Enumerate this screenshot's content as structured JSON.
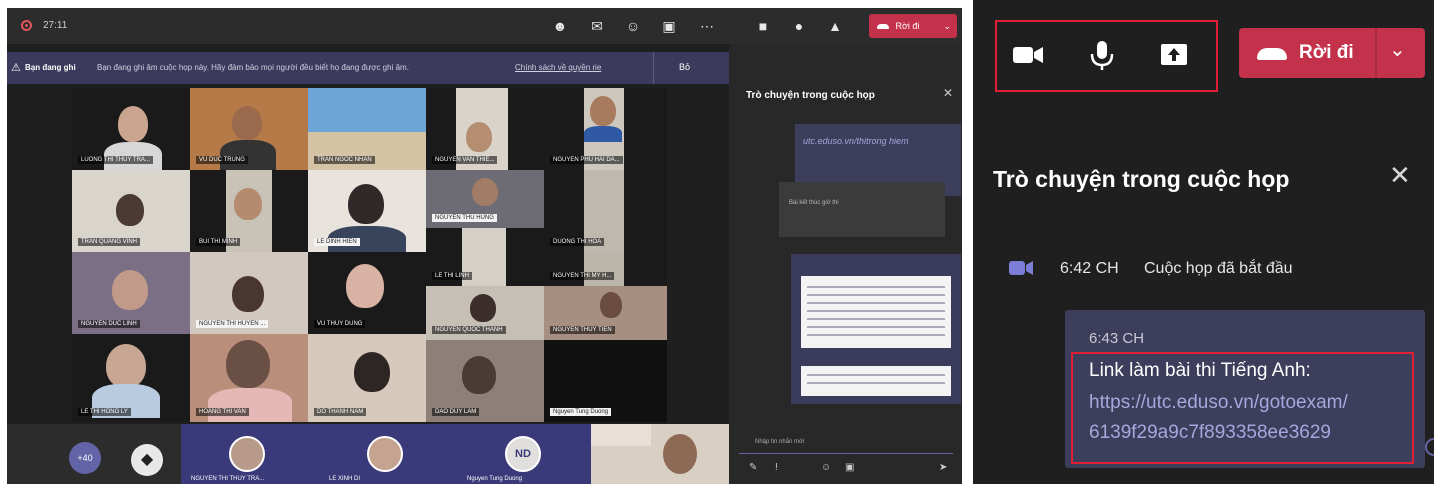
{
  "left_panel": {
    "timer": "27:11",
    "banner": {
      "title": "Bạn đang ghi",
      "text": "Bạn đang ghi âm cuộc họp này. Hãy đảm bảo mọi người đều biết họ đang được ghi âm.",
      "link": "Chính sách về quyền rie",
      "dismiss": "Bỏ"
    },
    "leave_label": "Rời đi",
    "chat_title": "Trò chuyện trong cuộc họp",
    "link_message": "utc.eduso.vn/thitrong hiem",
    "grey_message": "Bài kết thúc giờ thi",
    "compose_placeholder": "Nhập tin nhắn mới",
    "add_people_label": "+40",
    "participants": [
      {
        "name": "LUONG THI THUY TRA..."
      },
      {
        "name": "VU DUC TRUNG"
      },
      {
        "name": "TRAN NGOC NHAN"
      },
      {
        "name": "NGUYEN VAN THIE..."
      },
      {
        "name": "NGUYEN PHU HAI DA..."
      },
      {
        "name": "TRAN QUANG VINH"
      },
      {
        "name": "BUI THI MINH"
      },
      {
        "name": "LE DINH HIEN"
      },
      {
        "name": "NGUYEN THU HUNG"
      },
      {
        "name": "DUONG THI HOA"
      },
      {
        "name": "LE THI LINH"
      },
      {
        "name": "NGUYEN THI MY H..."
      },
      {
        "name": "NGUYEN DUC LINH"
      },
      {
        "name": "NGUYEN THI HUYEN ..."
      },
      {
        "name": "VU THUY DUNG"
      },
      {
        "name": "NGUYEN QUOC THANH"
      },
      {
        "name": "NGUYEN THUY TIEN"
      },
      {
        "name": "LE THI HONG LY"
      },
      {
        "name": "HOANG THI VAN"
      },
      {
        "name": "DO THANH NAM"
      },
      {
        "name": "DAO DUY LAM"
      },
      {
        "name": "Nguyen Tung Duong"
      }
    ],
    "attendees_strip": [
      {
        "name": "NGUYEN THI THUY TRA..."
      },
      {
        "name": "LE XINH DI"
      },
      {
        "name": "Nguyen Tung Duong",
        "initials": "ND"
      }
    ]
  },
  "right_panel": {
    "leave_label": "Rời đi",
    "chat_title": "Trò chuyện trong cuộc họp",
    "meeting_started": {
      "time": "6:42 CH",
      "text": "Cuộc họp đã bắt đầu"
    },
    "message": {
      "time": "6:43 CH",
      "body": "Link làm bài thi Tiếng Anh:",
      "link_line1": "https://utc.eduso.vn/gotoexam/",
      "link_line2": "6139f29a9c7f893358ee3629"
    }
  },
  "colors": {
    "leave_red": "#c4314b",
    "highlight_red": "#e01e35",
    "teams_purple": "#6264a7",
    "link_purple": "#a6a7dc",
    "dark_bg": "#201f1f"
  }
}
